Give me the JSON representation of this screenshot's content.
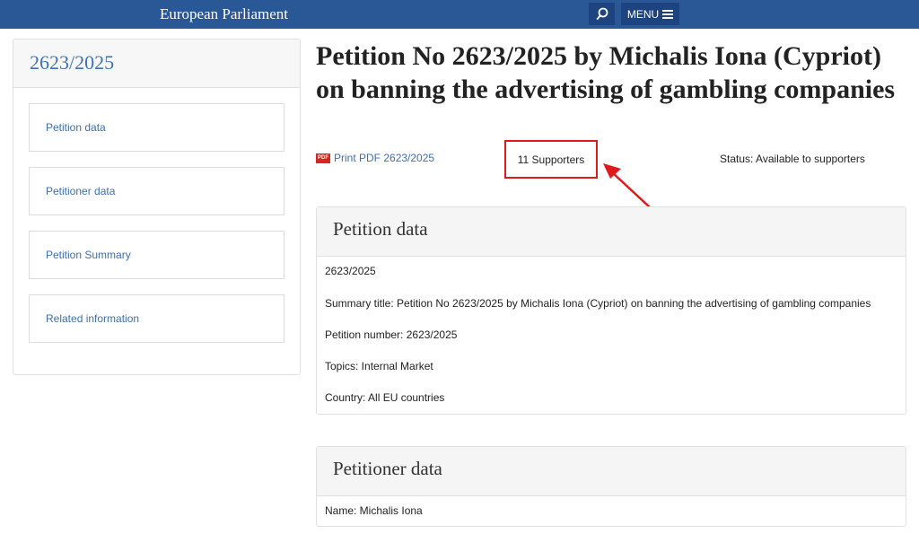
{
  "header": {
    "brand": "European Parliament",
    "menu_label": "MENU",
    "search_icon": "search-icon",
    "menu_icon": "hamburger-icon",
    "bg_color": "#2a5897"
  },
  "sidebar": {
    "title": "2623/2025",
    "items": [
      {
        "label": "Petition data"
      },
      {
        "label": "Petitioner data"
      },
      {
        "label": "Petition Summary"
      },
      {
        "label": "Related information"
      }
    ]
  },
  "main": {
    "title": "Petition No 2623/2025 by Michalis Iona (Cypriot) on banning the advertising of gambling companies",
    "pdf_badge": "PDF",
    "pdf_link": "Print PDF 2623/2025",
    "supporters": "11 Supporters",
    "status": "Status: Available to supporters",
    "highlight_color": "#e01a1a"
  },
  "petition_data": {
    "heading": "Petition data",
    "rows": [
      "2623/2025",
      "Summary title: Petition No 2623/2025 by Michalis Iona (Cypriot) on banning the advertising of gambling companies",
      "Petition number: 2623/2025",
      "Topics: Internal Market",
      "Country: All EU countries"
    ]
  },
  "petitioner_data": {
    "heading": "Petitioner data",
    "rows": [
      "Name: Michalis Iona"
    ]
  }
}
